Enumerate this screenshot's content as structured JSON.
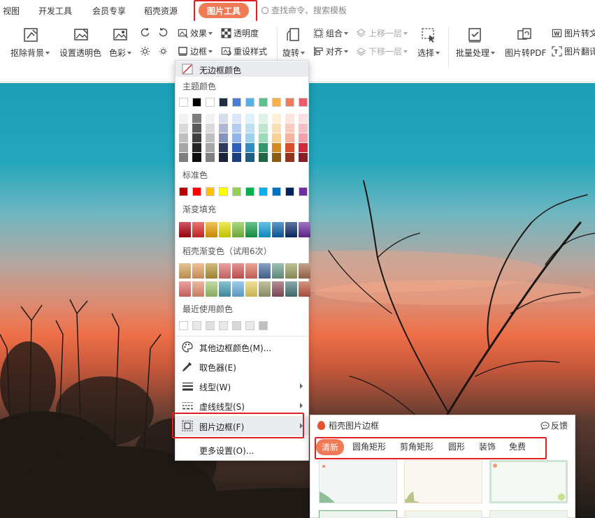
{
  "menubar": {
    "tabs": [
      "视图",
      "开发工具",
      "会员专享",
      "稻壳资源",
      "图片工具"
    ],
    "active_tab": "图片工具",
    "search_placeholder": "查找命令、搜索模板"
  },
  "ribbon": {
    "remove_bg": "抠除背景",
    "set_transparent": "设置透明色",
    "color": "色彩",
    "effect": "效果",
    "border": "边框",
    "transparency": "透明度",
    "reset_style": "重设样式",
    "rotate": "旋转",
    "group": "组合",
    "align": "对齐",
    "bring_forward": "上移一层",
    "send_backward": "下移一层",
    "select": "选择",
    "batch": "批量处理",
    "to_pdf": "图片转PDF",
    "to_text": "图片转文",
    "translate": "图片翻译"
  },
  "dropdown": {
    "no_border": "无边框颜色",
    "theme_colors": "主题颜色",
    "standard_colors": "标准色",
    "gradient_fill": "渐变填充",
    "daoke_gradient": "稻壳渐变色（试用6次）",
    "recent_colors": "最近使用颜色",
    "more_colors": "其他边框颜色(M)...",
    "eyedropper": "取色器(E)",
    "line_type": "线型(W)",
    "dash_type": "虚线线型(S)",
    "picture_border": "图片边框(F)",
    "more_settings": "更多设置(O)..."
  },
  "colors": {
    "accent": "#f07a55",
    "highlight_box": "#e02020",
    "theme_row": [
      "#ffffff",
      "#000000",
      "#ffffff",
      "#1f2d45",
      "#4a7cd6",
      "#5aaee0",
      "#5dbf8a",
      "#f4b04a",
      "#ef7d5c",
      "#ea5d6b"
    ],
    "theme_columns": [
      [
        "#f2f2f2",
        "#d9d9d9",
        "#bfbfbf",
        "#a6a6a6",
        "#7f7f7f"
      ],
      [
        "#7f7f7f",
        "#595959",
        "#404040",
        "#262626",
        "#0d0d0d"
      ],
      [
        "#f2f2f2",
        "#d9d9d9",
        "#bfbfbf",
        "#a6a6a6",
        "#808080"
      ],
      [
        "#d6dcea",
        "#aeb8d4",
        "#8593bf",
        "#2c3b5e",
        "#1b2338"
      ],
      [
        "#dbe6f8",
        "#b6cdf1",
        "#92b4ea",
        "#2f5fb8",
        "#1f3f7a"
      ],
      [
        "#def0f9",
        "#bde1f3",
        "#9cd2ee",
        "#2e8ec4",
        "#1e5e82"
      ],
      [
        "#dff2e7",
        "#bee5cf",
        "#9dd9b8",
        "#36956a",
        "#246446"
      ],
      [
        "#fdefd9",
        "#fbdfb4",
        "#f8d08f",
        "#d48a1c",
        "#8d5c13"
      ],
      [
        "#fce5de",
        "#f9cbbd",
        "#f6b29d",
        "#d5502a",
        "#8e351c"
      ],
      [
        "#fbdfe2",
        "#f7bec5",
        "#f39ea8",
        "#cf2a3d",
        "#8a1c29"
      ]
    ],
    "standard_row": [
      "#c00000",
      "#ff0000",
      "#ffc000",
      "#ffff00",
      "#92d050",
      "#00b050",
      "#00b0f0",
      "#0070c0",
      "#002060",
      "#7030a0"
    ],
    "gradient_row": [
      "#b00010",
      "#e02a2a",
      "#e6a200",
      "#e2e000",
      "#7fc241",
      "#14a04a",
      "#12a0d8",
      "#0a62b0",
      "#0b2c6b",
      "#6b2aa0"
    ],
    "daoke_row1": [
      "#d7a45c",
      "#e8a060",
      "#b8963a",
      "#e07070",
      "#d85a5a",
      "#e07060",
      "#4a6ea0",
      "#6a9e8a",
      "#9aa060",
      "#a87050"
    ],
    "daoke_row2": [
      "#e0706a",
      "#e89070",
      "#a0c870",
      "#48a0b8",
      "#6ab0e0",
      "#e8d060",
      "#a0a070",
      "#8e5060",
      "#4a7a78",
      "#c05a40"
    ],
    "recent_row": [
      "#ffffff",
      "#e8e8e8",
      "#e0e0e0",
      "#e8e8e8",
      "#d8d8d8",
      "#e8e8e8",
      "#c0c0c0"
    ]
  },
  "subpanel": {
    "title": "稻壳图片边框",
    "feedback": "反馈",
    "tabs": [
      "清新",
      "圆角矩形",
      "剪角矩形",
      "圆形",
      "装饰",
      "免费"
    ],
    "active_tab": "清新"
  }
}
